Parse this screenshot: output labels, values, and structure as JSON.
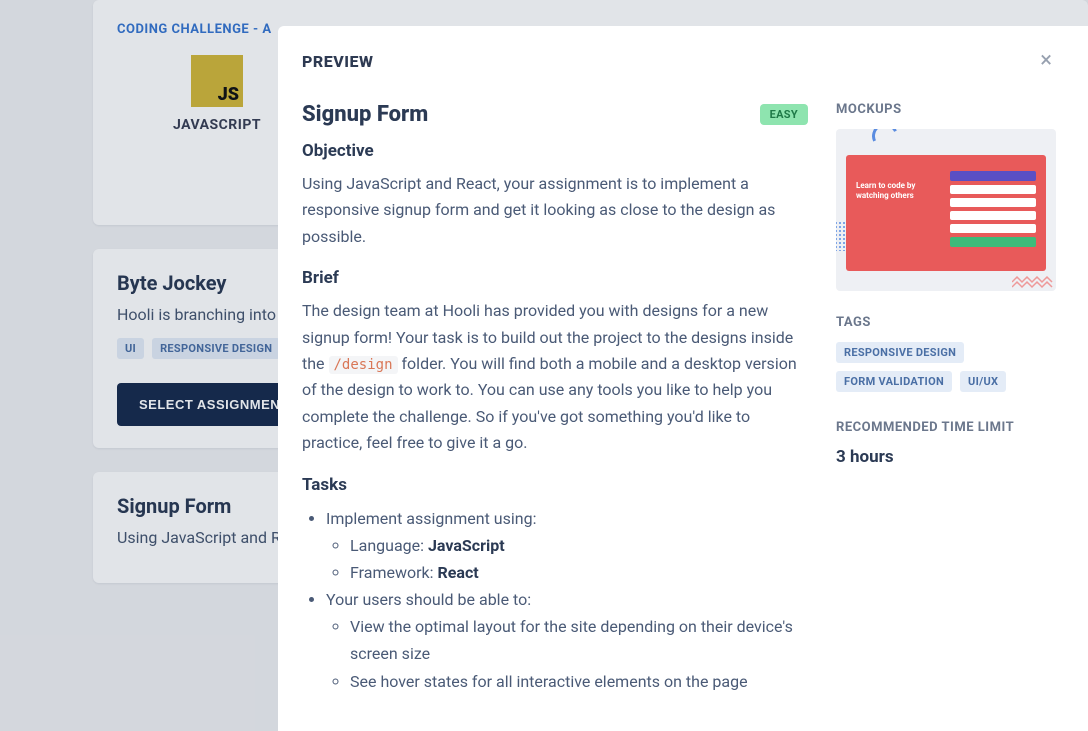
{
  "page": {
    "header": "CODING CHALLENGE - A",
    "logo_label": "JAVASCRIPT",
    "logo_text": "JS"
  },
  "cards": {
    "byteJockey": {
      "title": "Byte Jockey",
      "desc": "Hooli is branching into",
      "tags": [
        "UI",
        "RESPONSIVE DESIGN"
      ],
      "cta": "SELECT ASSIGNMEN"
    },
    "signupForm": {
      "title": "Signup Form",
      "desc": "Using JavaScript and R"
    }
  },
  "modal": {
    "title": "PREVIEW",
    "close": "×",
    "content": {
      "title": "Signup Form",
      "badge": "EASY",
      "objective_h": "Objective",
      "objective": "Using JavaScript and React, your assignment is to implement a responsive signup form and get it looking as close to the design as possible.",
      "brief_h": "Brief",
      "brief_pre": "The design team at Hooli has provided you with designs for a new signup form! Your task is to build out the project to the designs inside the ",
      "brief_code": "/design",
      "brief_post": " folder. You will find both a mobile and a desktop version of the design to work to. You can use any tools you like to help you complete the challenge. So if you've got something you'd like to practice, feel free to give it a go.",
      "tasks_h": "Tasks",
      "tasks": {
        "implement": "Implement assignment using:",
        "lang_label": "Language: ",
        "lang_value": "JavaScript",
        "fw_label": "Framework: ",
        "fw_value": "React",
        "users": "Your users should be able to:",
        "u1": "View the optimal layout for the site depending on their device's screen size",
        "u2": "See hover states for all interactive elements on the page"
      }
    },
    "sidebar": {
      "mockups_h": "MOCKUPS",
      "mockup_text": "Learn to code by watching others",
      "tags_h": "TAGS",
      "tags": [
        "RESPONSIVE DESIGN",
        "FORM VALIDATION",
        "UI/UX"
      ],
      "time_h": "RECOMMENDED TIME LIMIT",
      "time_val": "3 hours"
    }
  }
}
